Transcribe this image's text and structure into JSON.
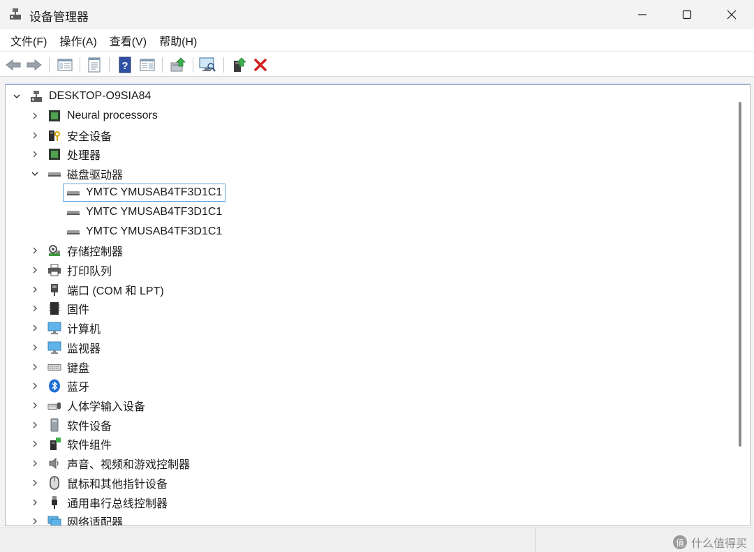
{
  "window": {
    "title": "设备管理器",
    "controls": {
      "minimize": "minimize-icon",
      "maximize": "maximize-icon",
      "close": "close-icon"
    }
  },
  "menu": [
    {
      "label": "文件(F)"
    },
    {
      "label": "操作(A)"
    },
    {
      "label": "查看(V)"
    },
    {
      "label": "帮助(H)"
    }
  ],
  "toolbar": {
    "buttons": [
      "back-arrow-icon",
      "forward-arrow-icon",
      "show-hide-console-tree-icon",
      "properties-icon",
      "help-icon",
      "view-icon",
      "update-driver-icon",
      "scan-hardware-icon",
      "enable-device-icon",
      "uninstall-device-icon"
    ]
  },
  "tree": {
    "root": {
      "label": "DESKTOP-O9SIA84",
      "icon": "computer-tree-icon",
      "expanded": true
    },
    "items": [
      {
        "label": "Neural processors",
        "icon": "chip-icon",
        "expanded": false
      },
      {
        "label": "安全设备",
        "icon": "security-device-icon",
        "expanded": false
      },
      {
        "label": "处理器",
        "icon": "processor-icon",
        "expanded": false
      },
      {
        "label": "磁盘驱动器",
        "icon": "disk-drive-icon",
        "expanded": true,
        "children": [
          {
            "label": "YMTC YMUSAB4TF3D1C1",
            "selected": true
          },
          {
            "label": "YMTC YMUSAB4TF3D1C1",
            "selected": false
          },
          {
            "label": "YMTC YMUSAB4TF3D1C1",
            "selected": false
          }
        ]
      },
      {
        "label": "存储控制器",
        "icon": "storage-controller-icon",
        "expanded": false
      },
      {
        "label": "打印队列",
        "icon": "printer-icon",
        "expanded": false
      },
      {
        "label": "端口 (COM 和 LPT)",
        "icon": "port-icon",
        "expanded": false
      },
      {
        "label": "固件",
        "icon": "firmware-icon",
        "expanded": false
      },
      {
        "label": "计算机",
        "icon": "computer-icon",
        "expanded": false
      },
      {
        "label": "监视器",
        "icon": "monitor-icon",
        "expanded": false
      },
      {
        "label": "键盘",
        "icon": "keyboard-icon",
        "expanded": false
      },
      {
        "label": "蓝牙",
        "icon": "bluetooth-icon",
        "expanded": false
      },
      {
        "label": "人体学输入设备",
        "icon": "hid-icon",
        "expanded": false
      },
      {
        "label": "软件设备",
        "icon": "software-device-icon",
        "expanded": false
      },
      {
        "label": "软件组件",
        "icon": "software-component-icon",
        "expanded": false
      },
      {
        "label": "声音、视频和游戏控制器",
        "icon": "speaker-icon",
        "expanded": false
      },
      {
        "label": "鼠标和其他指针设备",
        "icon": "mouse-icon",
        "expanded": false
      },
      {
        "label": "通用串行总线控制器",
        "icon": "usb-icon",
        "expanded": false
      },
      {
        "label": "网络适配器",
        "icon": "network-adapter-icon",
        "expanded": false
      }
    ]
  },
  "watermark": {
    "badge": "值",
    "text": "什么值得买"
  },
  "colors": {
    "selection_border": "#5fa2dd",
    "delete_red": "#d21f1f",
    "bluetooth_blue": "#1f6fd6"
  }
}
